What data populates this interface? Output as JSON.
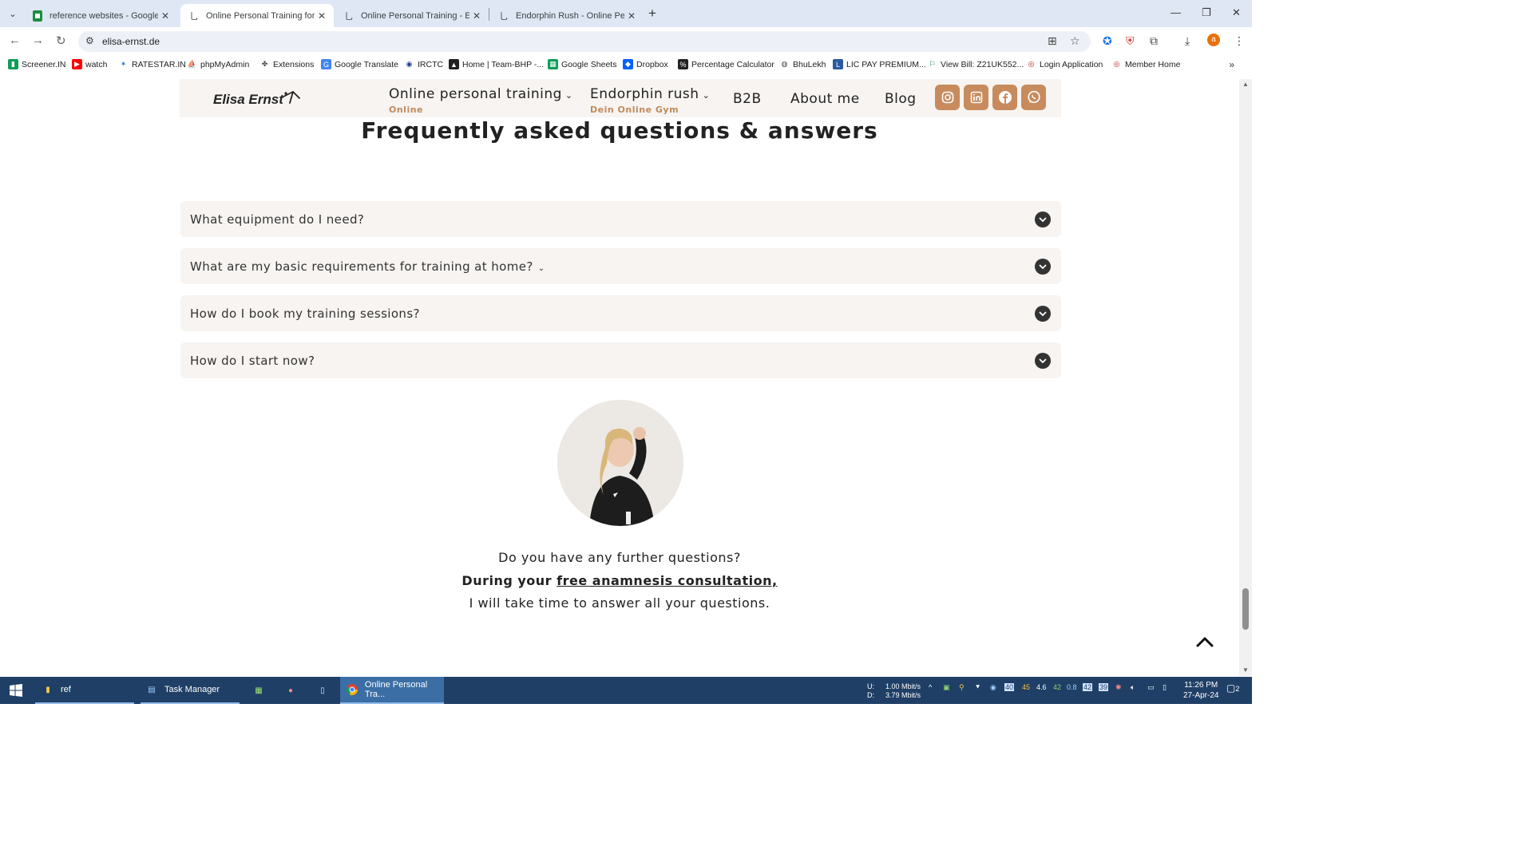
{
  "browser": {
    "tabs": [
      {
        "title": "reference websites - Google Sh",
        "icon": "sheets-icon",
        "active": false
      },
      {
        "title": "Online Personal Training for Wo",
        "icon": "site-icon",
        "active": true
      },
      {
        "title": "Online Personal Training - Elisa",
        "icon": "site-icon",
        "active": false
      },
      {
        "title": "Endorphin Rush - Online Perso",
        "icon": "site-icon",
        "active": false
      }
    ],
    "url": "elisa-ernst.de",
    "bookmarks": [
      "Screener.IN",
      "watch",
      "RATESTAR.IN",
      "phpMyAdmin",
      "Extensions",
      "Google Translate",
      "IRCTC",
      "Home | Team-BHP -...",
      "Google Sheets",
      "Dropbox",
      "Percentage Calculator",
      "BhuLekh",
      "LIC PAY PREMIUM...",
      "View Bill: Z21UK552...",
      "Login Application",
      "Member Home"
    ],
    "profile_letter": "a"
  },
  "site": {
    "logo": "Elisa Ernst",
    "nav": {
      "online_training": "Online personal training",
      "online_training_sub": "Online",
      "endorphin": "Endorphin rush",
      "endorphin_sub": "Dein Online Gym",
      "b2b": "B2B",
      "about": "About me",
      "blog": "Blog"
    },
    "social": [
      "instagram-icon",
      "linkedin-icon",
      "facebook-icon",
      "whatsapp-icon"
    ],
    "accent_color": "#c78b5d",
    "faq_title": "Frequently asked questions & answers",
    "faq": [
      "What equipment do I need?",
      "What are my basic requirements for training at home?",
      "How do I book my training sessions?",
      "How do I start now?"
    ],
    "further": {
      "line1": "Do you have any further questions?",
      "line2_prefix": "During your ",
      "line2_link": "free anamnesis consultation,",
      "line3": "I will take time to answer all your questions."
    }
  },
  "taskbar": {
    "items": [
      "ref",
      "Task Manager",
      "Online Personal Tra..."
    ],
    "net_up": "1.00 Mbit/s",
    "net_down": "3.79 Mbit/s",
    "net_up_label": "U:",
    "net_down_label": "D:",
    "time": "11:26 PM",
    "date": "27-Apr-24",
    "notif_count": "2"
  }
}
